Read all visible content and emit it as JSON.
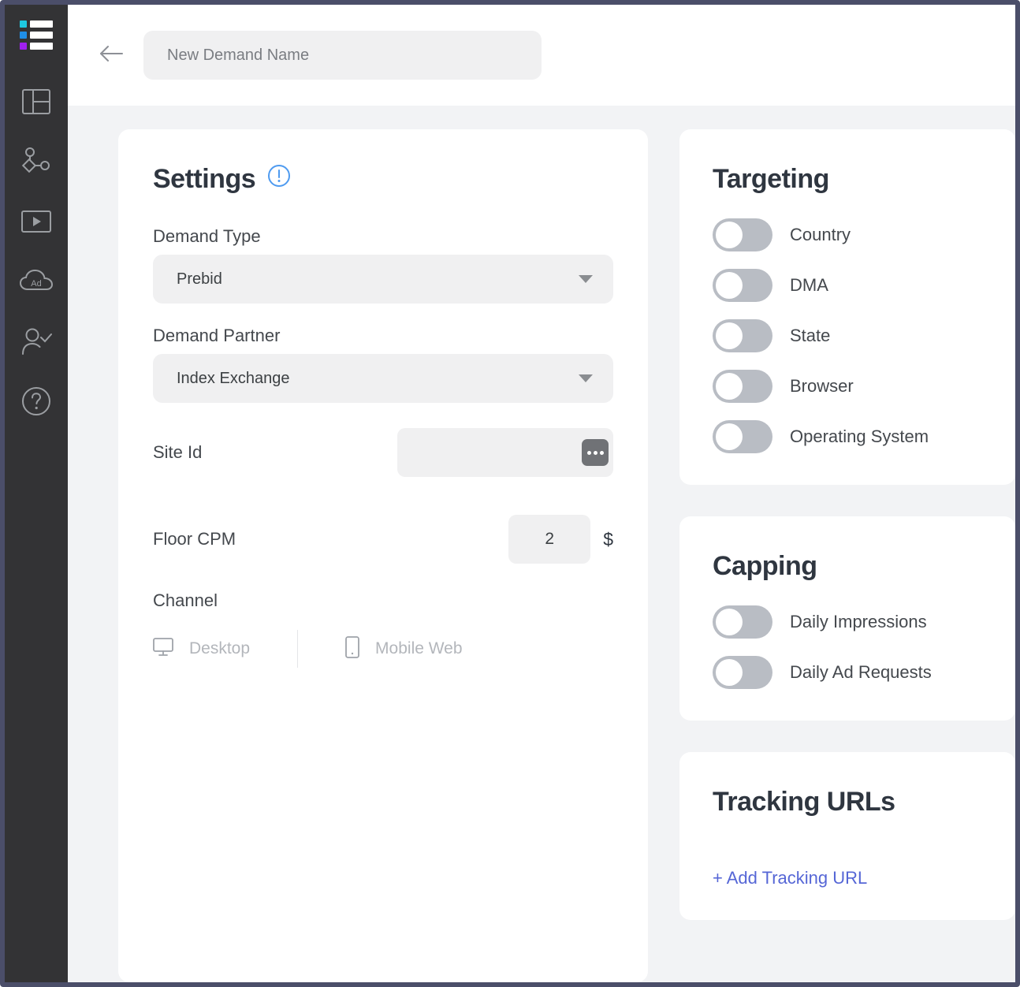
{
  "brand": {
    "logo_colors": [
      "#1ec8e0",
      "#1f8fe8",
      "#a020f0"
    ],
    "logo_bar_color": "#ffffff",
    "sidebar_bg": "#333335",
    "accent_blue": "#4f9bf0",
    "link_color": "#5566d6"
  },
  "sidebar": {
    "items": [
      {
        "icon": "logo-icon",
        "label": "Logo"
      },
      {
        "icon": "dashboard-layout-icon",
        "label": "Dashboard"
      },
      {
        "icon": "supply-nodes-icon",
        "label": "Supply"
      },
      {
        "icon": "video-player-icon",
        "label": "Video"
      },
      {
        "icon": "ad-cloud-icon",
        "label": "Ad Cloud"
      },
      {
        "icon": "user-check-icon",
        "label": "Users"
      },
      {
        "icon": "help-circle-icon",
        "label": "Help"
      }
    ]
  },
  "header": {
    "back_icon": "arrow-left-icon",
    "name_value": "",
    "name_placeholder": "New Demand Name"
  },
  "settings": {
    "title": "Settings",
    "info_icon": "info-exclamation-icon",
    "demand_type": {
      "label": "Demand Type",
      "value": "Prebid",
      "options": [
        "Prebid"
      ]
    },
    "demand_partner": {
      "label": "Demand Partner",
      "value": "Index Exchange",
      "options": [
        "Index Exchange"
      ]
    },
    "site_id": {
      "label": "Site Id",
      "value": "",
      "placeholder": "",
      "more_button_icon": "ellipsis-icon"
    },
    "floor_cpm": {
      "label": "Floor CPM",
      "value": "2",
      "currency": "$"
    },
    "channel": {
      "label": "Channel",
      "options": [
        {
          "label": "Desktop",
          "icon": "desktop-monitor-icon",
          "selected": false
        },
        {
          "label": "Mobile Web",
          "icon": "mobile-phone-icon",
          "selected": false
        }
      ]
    }
  },
  "targeting": {
    "title": "Targeting",
    "toggles": [
      {
        "label": "Country",
        "on": false
      },
      {
        "label": "DMA",
        "on": false
      },
      {
        "label": "State",
        "on": false
      },
      {
        "label": "Browser",
        "on": false
      },
      {
        "label": "Operating System",
        "on": false
      }
    ]
  },
  "capping": {
    "title": "Capping",
    "toggles": [
      {
        "label": "Daily Impressions",
        "on": false
      },
      {
        "label": "Daily Ad Requests",
        "on": false
      }
    ]
  },
  "tracking": {
    "title": "Tracking URLs",
    "add_link": "+ Add Tracking URL"
  }
}
